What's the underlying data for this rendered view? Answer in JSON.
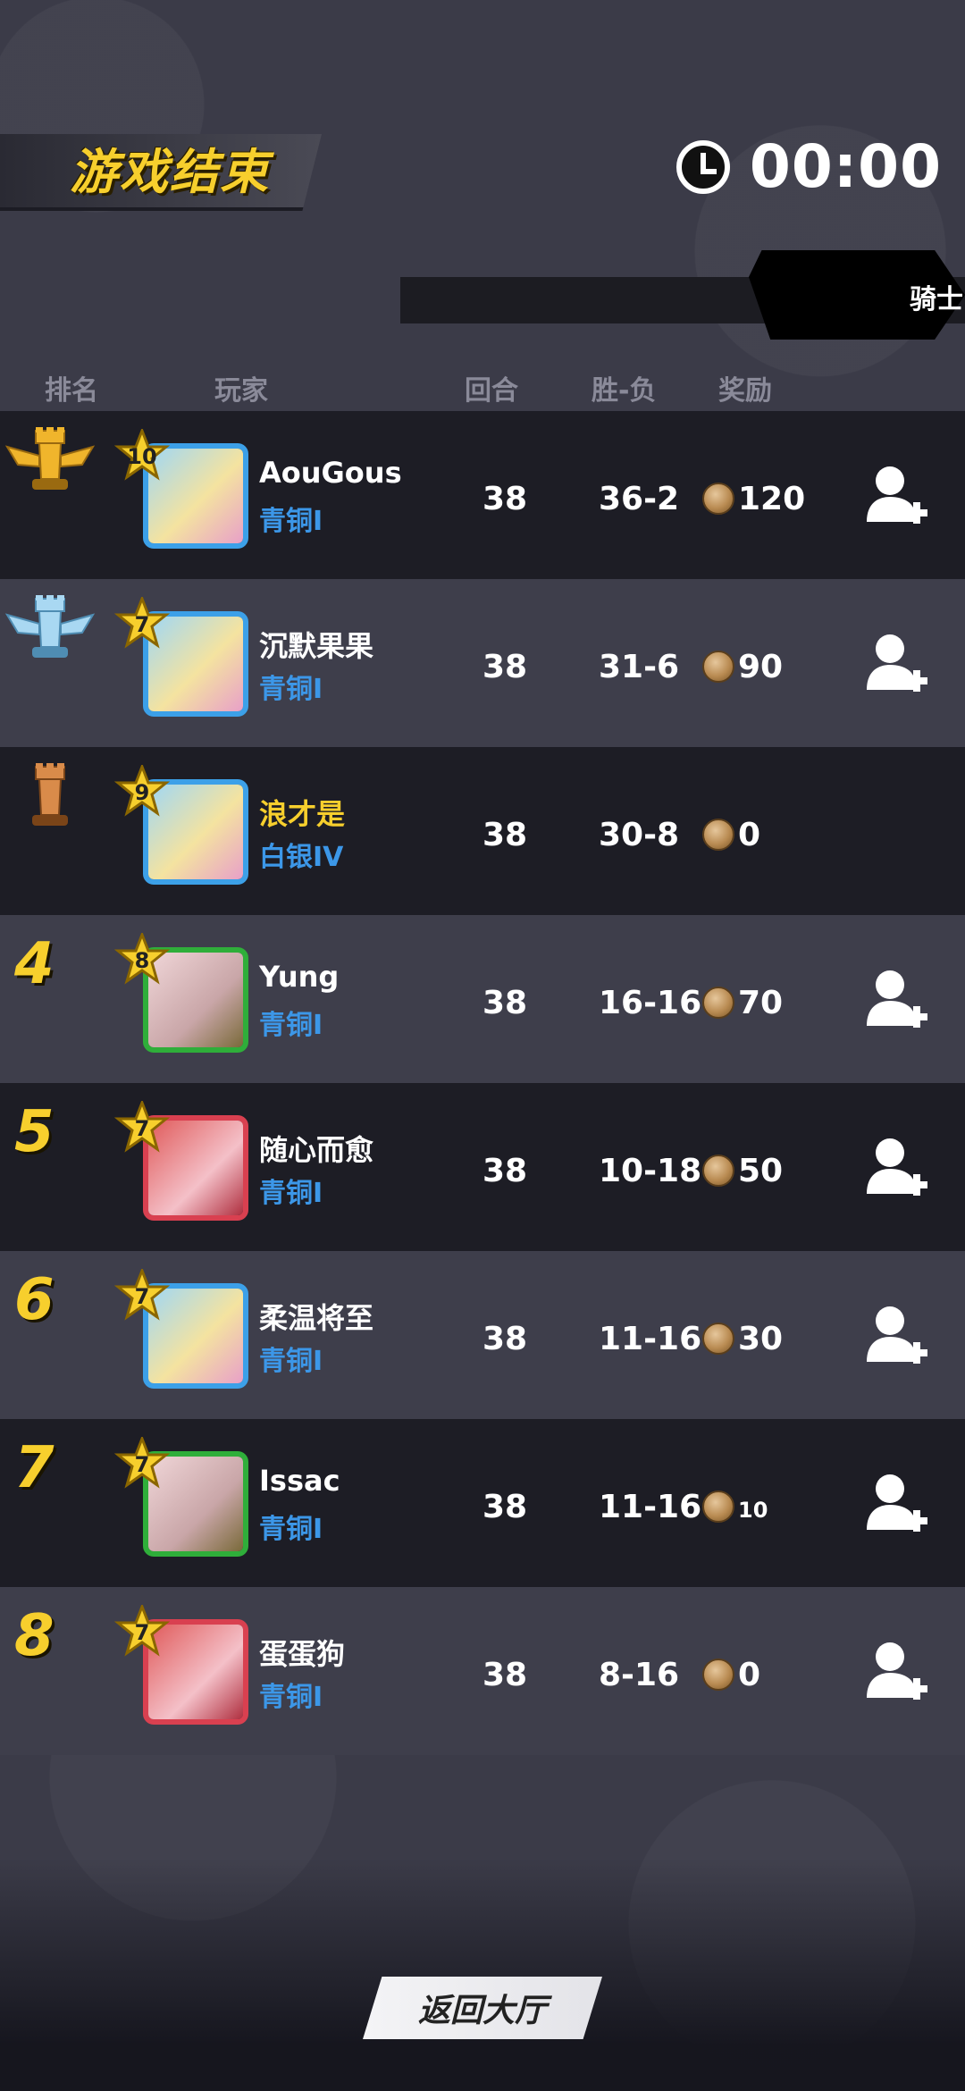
{
  "header": {
    "title": "游戏结束",
    "timer": "00:00",
    "knight_label": "骑士"
  },
  "columns": {
    "rank": "排名",
    "player": "玩家",
    "rounds": "回合",
    "win_loss": "胜-负",
    "reward": "奖励"
  },
  "players": [
    {
      "rank": "1",
      "rank_icon": "gold-chess-rook-winged-icon",
      "level": "10",
      "name": "AouGous",
      "tier": "青铜I",
      "rounds": "38",
      "win_loss": "36-2",
      "reward": "120",
      "avatar_frame": "blue",
      "add_friend": true,
      "row_style": "dark",
      "name_color": "white"
    },
    {
      "rank": "2",
      "rank_icon": "silver-chess-rook-winged-icon",
      "level": "7",
      "name": "沉默果果",
      "tier": "青铜I",
      "rounds": "38",
      "win_loss": "31-6",
      "reward": "90",
      "avatar_frame": "blue",
      "add_friend": true,
      "row_style": "light",
      "name_color": "white"
    },
    {
      "rank": "3",
      "rank_icon": "bronze-chess-rook-icon",
      "level": "9",
      "name": "浪才是",
      "tier": "白银IV",
      "rounds": "38",
      "win_loss": "30-8",
      "reward": "0",
      "avatar_frame": "blue",
      "add_friend": false,
      "row_style": "dark",
      "name_color": "gold"
    },
    {
      "rank": "4",
      "rank_icon": "",
      "level": "8",
      "name": "Yung",
      "tier": "青铜I",
      "rounds": "38",
      "win_loss": "16-16",
      "reward": "70",
      "avatar_frame": "green",
      "add_friend": true,
      "row_style": "light",
      "name_color": "white"
    },
    {
      "rank": "5",
      "rank_icon": "",
      "level": "7",
      "name": "随心而愈",
      "tier": "青铜I",
      "rounds": "38",
      "win_loss": "10-18",
      "reward": "50",
      "avatar_frame": "red",
      "add_friend": true,
      "row_style": "dark",
      "name_color": "white"
    },
    {
      "rank": "6",
      "rank_icon": "",
      "level": "7",
      "name": "柔温将至",
      "tier": "青铜I",
      "rounds": "38",
      "win_loss": "11-16",
      "reward": "30",
      "avatar_frame": "blue",
      "add_friend": true,
      "row_style": "light",
      "name_color": "white"
    },
    {
      "rank": "7",
      "rank_icon": "",
      "level": "7",
      "name": "Issac",
      "tier": "青铜I",
      "rounds": "38",
      "win_loss": "11-16",
      "reward": "10",
      "avatar_frame": "green",
      "add_friend": true,
      "row_style": "dark",
      "name_color": "white"
    },
    {
      "rank": "8",
      "rank_icon": "",
      "level": "7",
      "name": "蛋蛋狗",
      "tier": "青铜I",
      "rounds": "38",
      "win_loss": "8-16",
      "reward": "0",
      "avatar_frame": "red",
      "add_friend": true,
      "row_style": "light",
      "name_color": "white"
    }
  ],
  "footer": {
    "return_label": "返回大厅"
  },
  "colors": {
    "gold": "#f7cf2d",
    "tier_blue": "#3c97e8",
    "row_dark": "#1d1d25",
    "row_light": "#3e3e4b"
  }
}
